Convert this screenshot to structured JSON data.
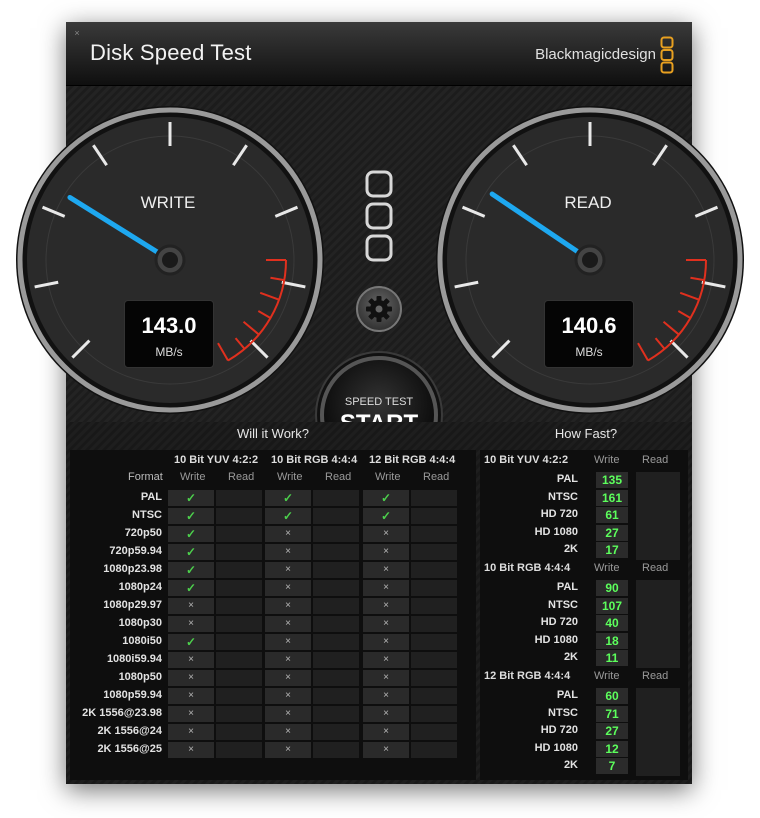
{
  "window": {
    "title": "Disk Speed Test",
    "brand": "Blackmagicdesign",
    "close_symbol": "×"
  },
  "gauges": {
    "write": {
      "label": "WRITE",
      "value": "143.0",
      "unit": "MB/s"
    },
    "read": {
      "label": "READ",
      "value": "140.6",
      "unit": "MB/s"
    }
  },
  "start_button": {
    "line1": "SPEED TEST",
    "line2": "START"
  },
  "will_it_work": {
    "title": "Will it Work?",
    "format_label": "Format",
    "groups": [
      "10 Bit YUV 4:2:2",
      "10 Bit RGB 4:4:4",
      "12 Bit RGB 4:4:4"
    ],
    "write_label": "Write",
    "read_label": "Read",
    "rows": [
      {
        "format": "PAL",
        "w": [
          true,
          true,
          true
        ]
      },
      {
        "format": "NTSC",
        "w": [
          true,
          true,
          true
        ]
      },
      {
        "format": "720p50",
        "w": [
          true,
          false,
          false
        ]
      },
      {
        "format": "720p59.94",
        "w": [
          true,
          false,
          false
        ]
      },
      {
        "format": "1080p23.98",
        "w": [
          true,
          false,
          false
        ]
      },
      {
        "format": "1080p24",
        "w": [
          true,
          false,
          false
        ]
      },
      {
        "format": "1080p29.97",
        "w": [
          false,
          false,
          false
        ]
      },
      {
        "format": "1080p30",
        "w": [
          false,
          false,
          false
        ]
      },
      {
        "format": "1080i50",
        "w": [
          true,
          false,
          false
        ]
      },
      {
        "format": "1080i59.94",
        "w": [
          false,
          false,
          false
        ]
      },
      {
        "format": "1080p50",
        "w": [
          false,
          false,
          false
        ]
      },
      {
        "format": "1080p59.94",
        "w": [
          false,
          false,
          false
        ]
      },
      {
        "format": "2K 1556@23.98",
        "w": [
          false,
          false,
          false
        ]
      },
      {
        "format": "2K 1556@24",
        "w": [
          false,
          false,
          false
        ]
      },
      {
        "format": "2K 1556@25",
        "w": [
          false,
          false,
          false
        ]
      }
    ]
  },
  "how_fast": {
    "title": "How Fast?",
    "write_label": "Write",
    "read_label": "Read",
    "groups": [
      {
        "name": "10 Bit YUV 4:2:2",
        "rows": [
          {
            "format": "PAL",
            "write": "135"
          },
          {
            "format": "NTSC",
            "write": "161"
          },
          {
            "format": "HD 720",
            "write": "61"
          },
          {
            "format": "HD 1080",
            "write": "27"
          },
          {
            "format": "2K",
            "write": "17"
          }
        ]
      },
      {
        "name": "10 Bit RGB 4:4:4",
        "rows": [
          {
            "format": "PAL",
            "write": "90"
          },
          {
            "format": "NTSC",
            "write": "107"
          },
          {
            "format": "HD 720",
            "write": "40"
          },
          {
            "format": "HD 1080",
            "write": "18"
          },
          {
            "format": "2K",
            "write": "11"
          }
        ]
      },
      {
        "name": "12 Bit RGB 4:4:4",
        "rows": [
          {
            "format": "PAL",
            "write": "60"
          },
          {
            "format": "NTSC",
            "write": "71"
          },
          {
            "format": "HD 720",
            "write": "27"
          },
          {
            "format": "HD 1080",
            "write": "12"
          },
          {
            "format": "2K",
            "write": "7"
          }
        ]
      }
    ]
  },
  "marks": {
    "yes": "✓",
    "no": "×"
  },
  "colors": {
    "needle": "#1ea8f0",
    "redzone": "#e0301e",
    "speed_text": "#5cff5c",
    "check": "#4cd04c"
  },
  "icons": {
    "settings": "gear-icon",
    "logo": "blackmagic-logo-icon"
  }
}
